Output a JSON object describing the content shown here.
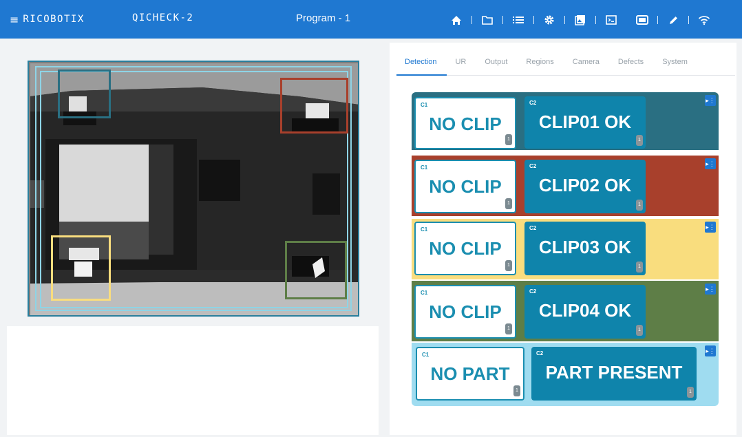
{
  "topbar": {
    "brand": "RICOBOTIX",
    "product": "QICHECK-2",
    "program": "Program - 1",
    "icons": [
      "home-icon",
      "folder-icon",
      "list-icon",
      "gear-icon",
      "gallery-icon",
      "terminal-icon",
      "camera-icon",
      "pencil-icon",
      "wifi-icon"
    ]
  },
  "tabs": [
    "Detection",
    "UR",
    "Output",
    "Regions",
    "Camera",
    "Defects",
    "System"
  ],
  "active_tab": "Detection",
  "rows": [
    {
      "color": "#2a6f82",
      "c1_label": "C1",
      "c1_text": "NO CLIP",
      "c1_count": "1",
      "c2_label": "C2",
      "c2_text": "CLIP01 OK",
      "c2_count": "1"
    },
    {
      "color": "#a8402c",
      "c1_label": "C1",
      "c1_text": "NO CLIP",
      "c1_count": "1",
      "c2_label": "C2",
      "c2_text": "CLIP02 OK",
      "c2_count": "1"
    },
    {
      "color": "#f9dd7e",
      "c1_label": "C1",
      "c1_text": "NO CLIP",
      "c1_count": "1",
      "c2_label": "C2",
      "c2_text": "CLIP03 OK",
      "c2_count": "1"
    },
    {
      "color": "#5e7e47",
      "c1_label": "C1",
      "c1_text": "NO CLIP",
      "c1_count": "1",
      "c2_label": "C2",
      "c2_text": "CLIP04 OK",
      "c2_count": "1"
    },
    {
      "color": "#9fdcf0",
      "c1_label": "C1",
      "c1_text": "NO PART",
      "c1_count": "1",
      "c2_label": "C2",
      "c2_text": "PART PRESENT",
      "c2_count": "1"
    }
  ],
  "colors": {
    "topbar": "#1f78d1",
    "accent": "#1f78d1",
    "card_blue": "#0f84ab"
  }
}
